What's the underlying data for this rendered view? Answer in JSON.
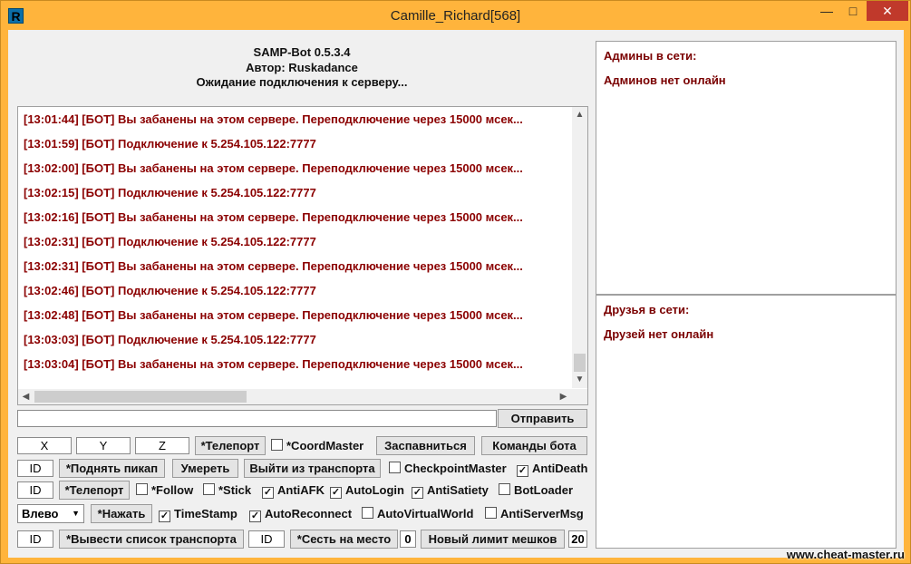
{
  "window": {
    "title": "Camille_Richard[568]",
    "app_icon_letter": "R"
  },
  "header": {
    "line1": "SAMP-Bot 0.5.3.4",
    "line2": "Автор: Ruskadance",
    "line3": "Ожидание подключения к серверу..."
  },
  "log": {
    "lines": [
      "[13:01:44] [БОТ] Вы забанены на этом сервере. Переподключение через 15000 мсек...",
      "[13:01:59] [БОТ] Подключение к 5.254.105.122:7777",
      "[13:02:00] [БОТ] Вы забанены на этом сервере. Переподключение через 15000 мсек...",
      "[13:02:15] [БОТ] Подключение к 5.254.105.122:7777",
      "[13:02:16] [БОТ] Вы забанены на этом сервере. Переподключение через 15000 мсек...",
      "[13:02:31] [БОТ] Подключение к 5.254.105.122:7777",
      "[13:02:31] [БОТ] Вы забанены на этом сервере. Переподключение через 15000 мсек...",
      "[13:02:46] [БОТ] Подключение к 5.254.105.122:7777",
      "[13:02:48] [БОТ] Вы забанены на этом сервере. Переподключение через 15000 мсек...",
      "[13:03:03] [БОТ] Подключение к 5.254.105.122:7777",
      "[13:03:04] [БОТ] Вы забанены на этом сервере. Переподключение через 15000 мсек..."
    ]
  },
  "send": {
    "input_value": "",
    "button": "Отправить"
  },
  "row1": {
    "x": "X",
    "y": "Y",
    "z": "Z",
    "teleport": "*Телепорт",
    "coordmaster": "*CoordMaster",
    "respawn": "Заспавниться",
    "bot_commands": "Команды бота"
  },
  "row2": {
    "id": "ID",
    "pickup": "*Поднять пикап",
    "die": "Умереть",
    "exit_vehicle": "Выйти из транспорта",
    "checkpointmaster": "CheckpointMaster",
    "antideath": "AntiDeath"
  },
  "row3": {
    "id": "ID",
    "teleport": "*Телепорт",
    "follow": "*Follow",
    "stick": "*Stick",
    "antiafk": "AntiAFK",
    "autologin": "AutoLogin",
    "antisatiety": "AntiSatiety",
    "botloader": "BotLoader"
  },
  "row4": {
    "direction": "Влево",
    "press": "*Нажать",
    "timestamp": "TimeStamp",
    "autoreconnect": "AutoReconnect",
    "autovirtualworld": "AutoVirtualWorld",
    "antiservermsg": "AntiServerMsg"
  },
  "row5": {
    "id1": "ID",
    "vehicle_list": "*Вывести список транспорта",
    "id2": "ID",
    "sit": "*Сесть на место",
    "seat_value": "0",
    "bag_limit": "Новый лимит мешков",
    "bag_value": "20"
  },
  "checks": {
    "coordmaster": false,
    "checkpointmaster": false,
    "antideath": true,
    "follow": false,
    "stick": false,
    "antiafk": true,
    "autologin": true,
    "antisatiety": true,
    "botloader": false,
    "timestamp": true,
    "autoreconnect": true,
    "autovirtualworld": false,
    "antiservermsg": false
  },
  "admins": {
    "title": "Админы в сети:",
    "status": "Админов нет онлайн"
  },
  "friends": {
    "title": "Друзья в сети:",
    "status": "Друзей нет онлайн"
  },
  "watermark": "www.cheat-master.ru",
  "colors": {
    "window_frame": "#ffb43c",
    "log_text": "#8b0000",
    "panel_text": "#7a0000",
    "close_button": "#c0392b"
  }
}
